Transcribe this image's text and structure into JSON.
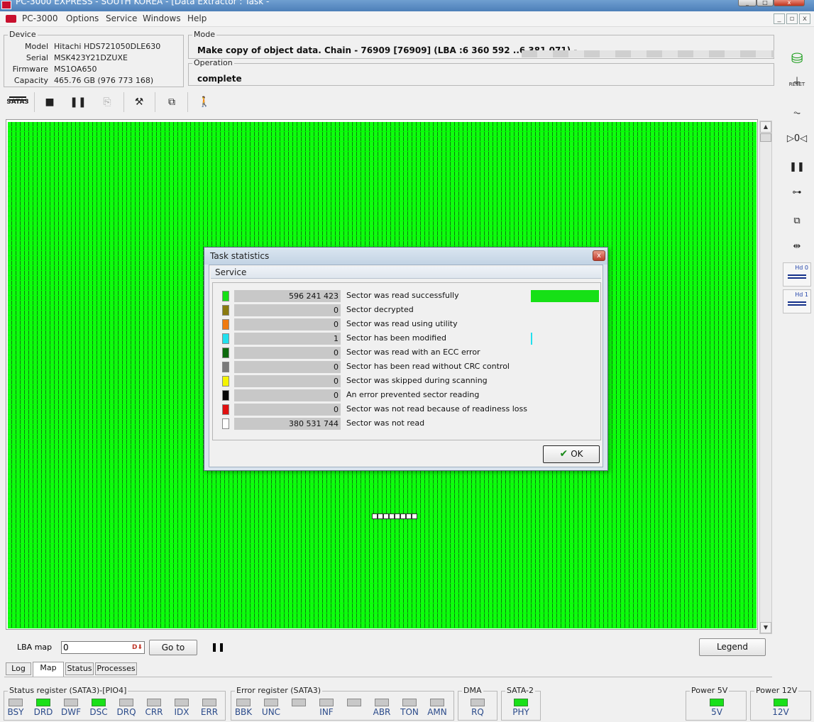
{
  "window": {
    "title": "PC-3000 EXPRESS - SOUTH KOREA - [Data Extractor : Task -"
  },
  "menu": {
    "app_name": "PC-3000",
    "items": [
      "Options",
      "Service",
      "Windows",
      "Help"
    ]
  },
  "device": {
    "group_title": "Device",
    "fields": [
      {
        "label": "Model",
        "value": "Hitachi HDS721050DLE630"
      },
      {
        "label": "Serial",
        "value": "MSK423Y21DZUXE"
      },
      {
        "label": "Firmware",
        "value": "MS1OA650"
      },
      {
        "label": "Capacity",
        "value": "465.76 GB (976 773 168)"
      }
    ]
  },
  "mode": {
    "group_title": "Mode",
    "text": "Make copy of object data. Chain - 76909 [76909] (LBA :6 360 592 ..6 381 071) -"
  },
  "operation": {
    "group_title": "Operation",
    "text": "complete"
  },
  "toolbar": {
    "interface_label": "SATA3"
  },
  "lba_bar": {
    "label": "LBA map",
    "input_value": "0",
    "goto_label": "Go to",
    "legend_label": "Legend"
  },
  "tabs": [
    {
      "label": "Log",
      "active": false
    },
    {
      "label": "Map",
      "active": true
    },
    {
      "label": "Status",
      "active": false
    },
    {
      "label": "Processes",
      "active": false
    }
  ],
  "right_panel": {
    "reset_label": "RESET",
    "hd0_label": "Hd 0",
    "hd1_label": "Hd 1"
  },
  "status_register": {
    "title": "Status register (SATA3)-[PIO4]",
    "leds": [
      {
        "label": "BSY",
        "on": false
      },
      {
        "label": "DRD",
        "on": true
      },
      {
        "label": "DWF",
        "on": false
      },
      {
        "label": "DSC",
        "on": true
      },
      {
        "label": "DRQ",
        "on": false
      },
      {
        "label": "CRR",
        "on": false
      },
      {
        "label": "IDX",
        "on": false
      },
      {
        "label": "ERR",
        "on": false
      }
    ]
  },
  "error_register": {
    "title": "Error register (SATA3)",
    "leds": [
      {
        "label": "BBK",
        "on": false
      },
      {
        "label": "UNC",
        "on": false
      },
      {
        "label": "",
        "on": false
      },
      {
        "label": "INF",
        "on": false
      },
      {
        "label": "",
        "on": false
      },
      {
        "label": "ABR",
        "on": false
      },
      {
        "label": "TON",
        "on": false
      },
      {
        "label": "AMN",
        "on": false
      }
    ]
  },
  "dma": {
    "title": "DMA",
    "led_label": "RQ",
    "on": false
  },
  "sata2": {
    "title": "SATA-2",
    "led_label": "PHY",
    "on": true
  },
  "power5": {
    "title": "Power 5V",
    "led_label": "5V",
    "on": true
  },
  "power12": {
    "title": "Power 12V",
    "led_label": "12V",
    "on": true
  },
  "dialog": {
    "title": "Task statistics",
    "section": "Service",
    "ok_label": "OK",
    "rows": [
      {
        "color": "#16e016",
        "count": "596 241 423",
        "description": "Sector was read successfully",
        "fraction": 0.6104
      },
      {
        "color": "#8a7a10",
        "count": "0",
        "description": "Sector decrypted",
        "fraction": 0
      },
      {
        "color": "#f07a10",
        "count": "0",
        "description": "Sector was read using utility",
        "fraction": 0
      },
      {
        "color": "#22e0ee",
        "count": "1",
        "description": "Sector has been modified",
        "fraction": 1e-05
      },
      {
        "color": "#0d6a0d",
        "count": "0",
        "description": "Sector was read with an ECC error",
        "fraction": 0
      },
      {
        "color": "#7a7a7a",
        "count": "0",
        "description": "Sector has been read without CRC control",
        "fraction": 0
      },
      {
        "color": "#f4f400",
        "count": "0",
        "description": "Sector was skipped during scanning",
        "fraction": 0
      },
      {
        "color": "#050505",
        "count": "0",
        "description": "An error prevented sector reading",
        "fraction": 0
      },
      {
        "color": "#e01010",
        "count": "0",
        "description": "Sector was not read because of readiness loss",
        "fraction": 0
      },
      {
        "color": "#ffffff",
        "count": "380 531 744",
        "description": "Sector was not read",
        "fraction": 0
      }
    ]
  }
}
